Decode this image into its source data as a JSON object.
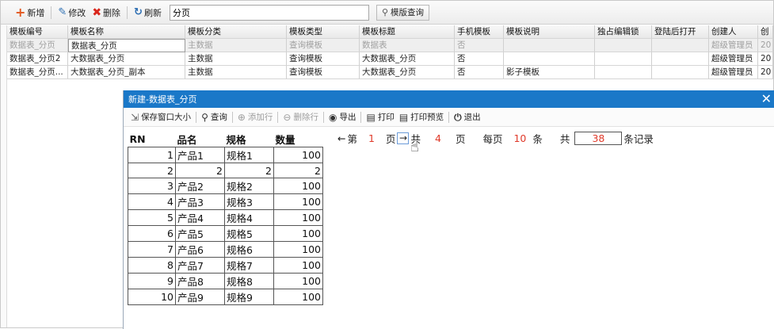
{
  "toolbar": {
    "add_label": "新增",
    "edit_label": "修改",
    "delete_label": "删除",
    "refresh_label": "刷新",
    "search_value": "分页",
    "query_label": "模版查询"
  },
  "grid": {
    "columns": [
      "模板编号",
      "模板名称",
      "模板分类",
      "模板类型",
      "模板标题",
      "手机模板",
      "模板说明",
      "独占编辑锁",
      "登陆后打开",
      "创建人",
      "创"
    ],
    "rows": [
      [
        "数据表_分页",
        "数据表_分页",
        "主数据",
        "查询模板",
        "数据表",
        "否",
        "",
        "",
        "",
        "超级管理员",
        "20"
      ],
      [
        "数据表_分页2",
        "大数据表_分页",
        "主数据",
        "查询模板",
        "大数据表_分页",
        "否",
        "",
        "",
        "",
        "超级管理员",
        "20"
      ],
      [
        "数据表_分页...",
        "大数据表_分页_副本",
        "主数据",
        "查询模板",
        "大数据表_分页",
        "否",
        "影子模板",
        "",
        "",
        "超级管理员",
        "20"
      ]
    ]
  },
  "dialog": {
    "title": "新建-数据表_分页",
    "toolbar": {
      "save_layout_label": "保存窗口大小",
      "query_label": "查询",
      "add_row_label": "添加行",
      "delete_row_label": "删除行",
      "export_label": "导出",
      "print_label": "打印",
      "print_preview_label": "打印预览",
      "exit_label": "退出"
    },
    "table": {
      "headers": [
        "RN",
        "品名",
        "规格",
        "数量"
      ],
      "rows": [
        [
          "1",
          "产品1",
          "规格1",
          "100"
        ],
        [
          "2",
          "2",
          "2",
          "2"
        ],
        [
          "3",
          "产品2",
          "规格2",
          "100"
        ],
        [
          "4",
          "产品3",
          "规格3",
          "100"
        ],
        [
          "5",
          "产品4",
          "规格4",
          "100"
        ],
        [
          "6",
          "产品5",
          "规格5",
          "100"
        ],
        [
          "7",
          "产品6",
          "规格6",
          "100"
        ],
        [
          "8",
          "产品7",
          "规格7",
          "100"
        ],
        [
          "9",
          "产品8",
          "规格8",
          "100"
        ],
        [
          "10",
          "产品9",
          "规格9",
          "100"
        ]
      ]
    },
    "pager": {
      "prev_symbol": "←",
      "page_prefix": "第",
      "page_number": "1",
      "page_suffix": "页",
      "next_symbol": "→",
      "total_prefix": "共",
      "total_pages": "4",
      "total_pages_suffix": "页",
      "per_page_prefix": "每页",
      "per_page": "10",
      "per_page_suffix": "条",
      "records_prefix": "共",
      "total_records": "38",
      "records_suffix": "条记录"
    }
  },
  "colors": {
    "title_bar": "#1a78c8",
    "accent_red": "#e03a2a",
    "add_icon": "#e2571f",
    "delete_icon": "#d9261c"
  }
}
